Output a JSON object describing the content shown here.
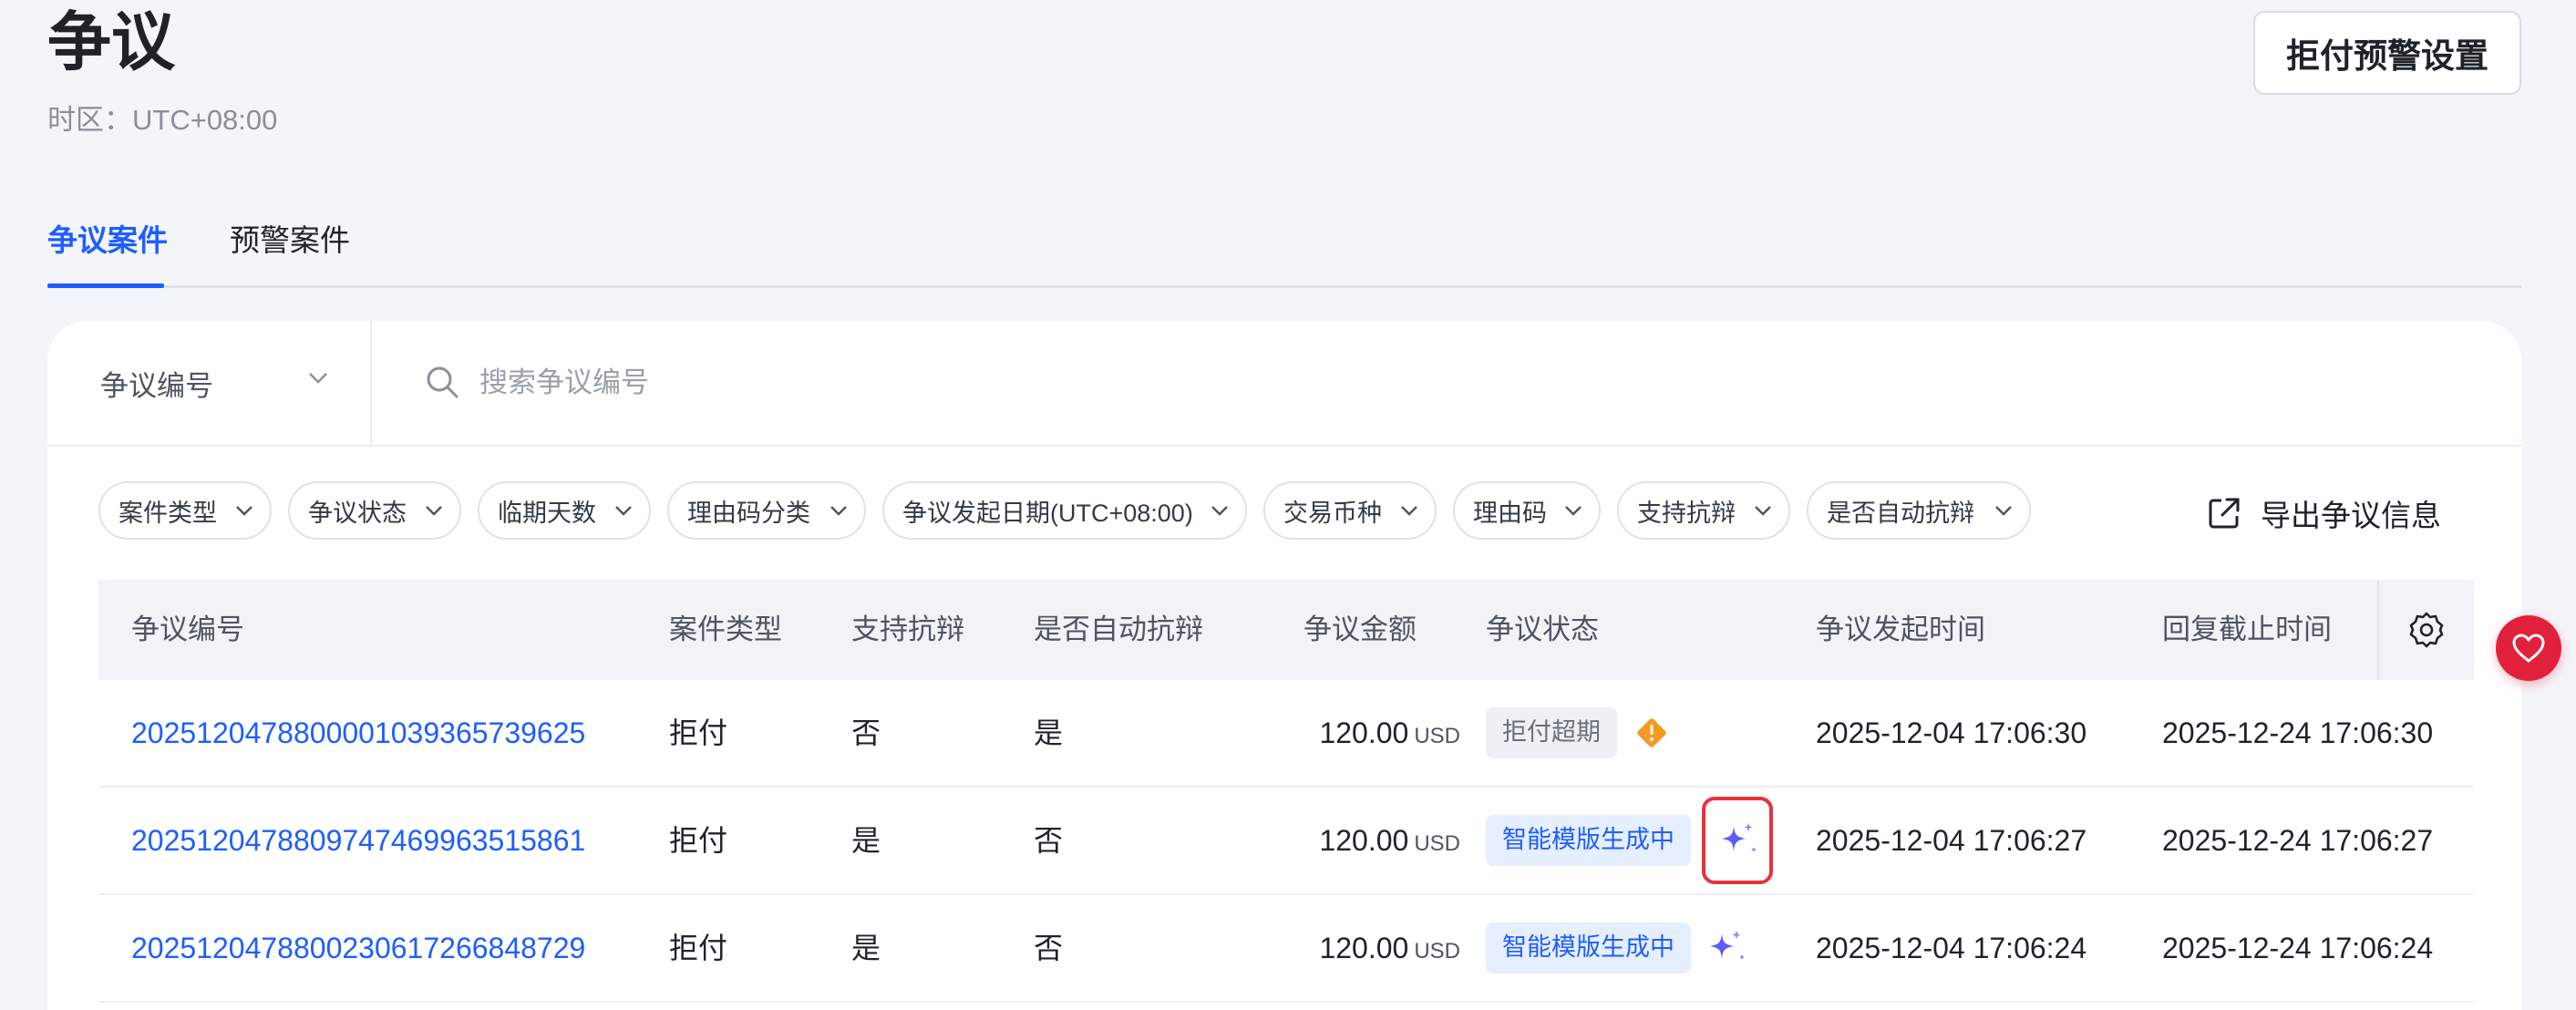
{
  "header": {
    "title": "争议",
    "timezone": "时区：UTC+08:00",
    "alert_settings_label": "拒付预警设置"
  },
  "tabs": [
    {
      "label": "争议案件",
      "active": true
    },
    {
      "label": "预警案件",
      "active": false
    }
  ],
  "search": {
    "type_selected": "争议编号",
    "placeholder": "搜索争议编号"
  },
  "filters": [
    {
      "label": "案件类型"
    },
    {
      "label": "争议状态"
    },
    {
      "label": "临期天数"
    },
    {
      "label": "理由码分类"
    },
    {
      "label": "争议发起日期(UTC+08:00)"
    },
    {
      "label": "交易币种"
    },
    {
      "label": "理由码"
    },
    {
      "label": "支持抗辩"
    },
    {
      "label": "是否自动抗辩"
    }
  ],
  "export_label": "导出争议信息",
  "table": {
    "columns": [
      "争议编号",
      "案件类型",
      "支持抗辩",
      "是否自动抗辩",
      "争议金额",
      "争议状态",
      "争议发起时间",
      "回复截止时间"
    ],
    "rows": [
      {
        "id": "2025120478800001039365739625",
        "case_type": "拒付",
        "supports_defense": "否",
        "auto_defense": "是",
        "amount": "120.00",
        "currency": "USD",
        "status": "拒付超期",
        "status_style": "gray",
        "status_icon": "warning-diamond-icon",
        "created_at": "2025-12-04 17:06:30",
        "deadline": "2025-12-24 17:06:30"
      },
      {
        "id": "2025120478809747469963515861",
        "case_type": "拒付",
        "supports_defense": "是",
        "auto_defense": "否",
        "amount": "120.00",
        "currency": "USD",
        "status": "智能模版生成中",
        "status_style": "blue",
        "status_icon": "ai-sparkle-icon",
        "created_at": "2025-12-04 17:06:27",
        "deadline": "2025-12-24 17:06:27"
      },
      {
        "id": "2025120478800230617266848729",
        "case_type": "拒付",
        "supports_defense": "是",
        "auto_defense": "否",
        "amount": "120.00",
        "currency": "USD",
        "status": "智能模版生成中",
        "status_style": "blue",
        "status_icon": "ai-sparkle-icon",
        "created_at": "2025-12-04 17:06:24",
        "deadline": "2025-12-24 17:06:24"
      }
    ]
  },
  "colors": {
    "accent": "#1e5eff",
    "warning": "#f59a23",
    "highlight": "#e8323c",
    "favorite": "#e1213b",
    "sparkle": "#6b6bff"
  }
}
